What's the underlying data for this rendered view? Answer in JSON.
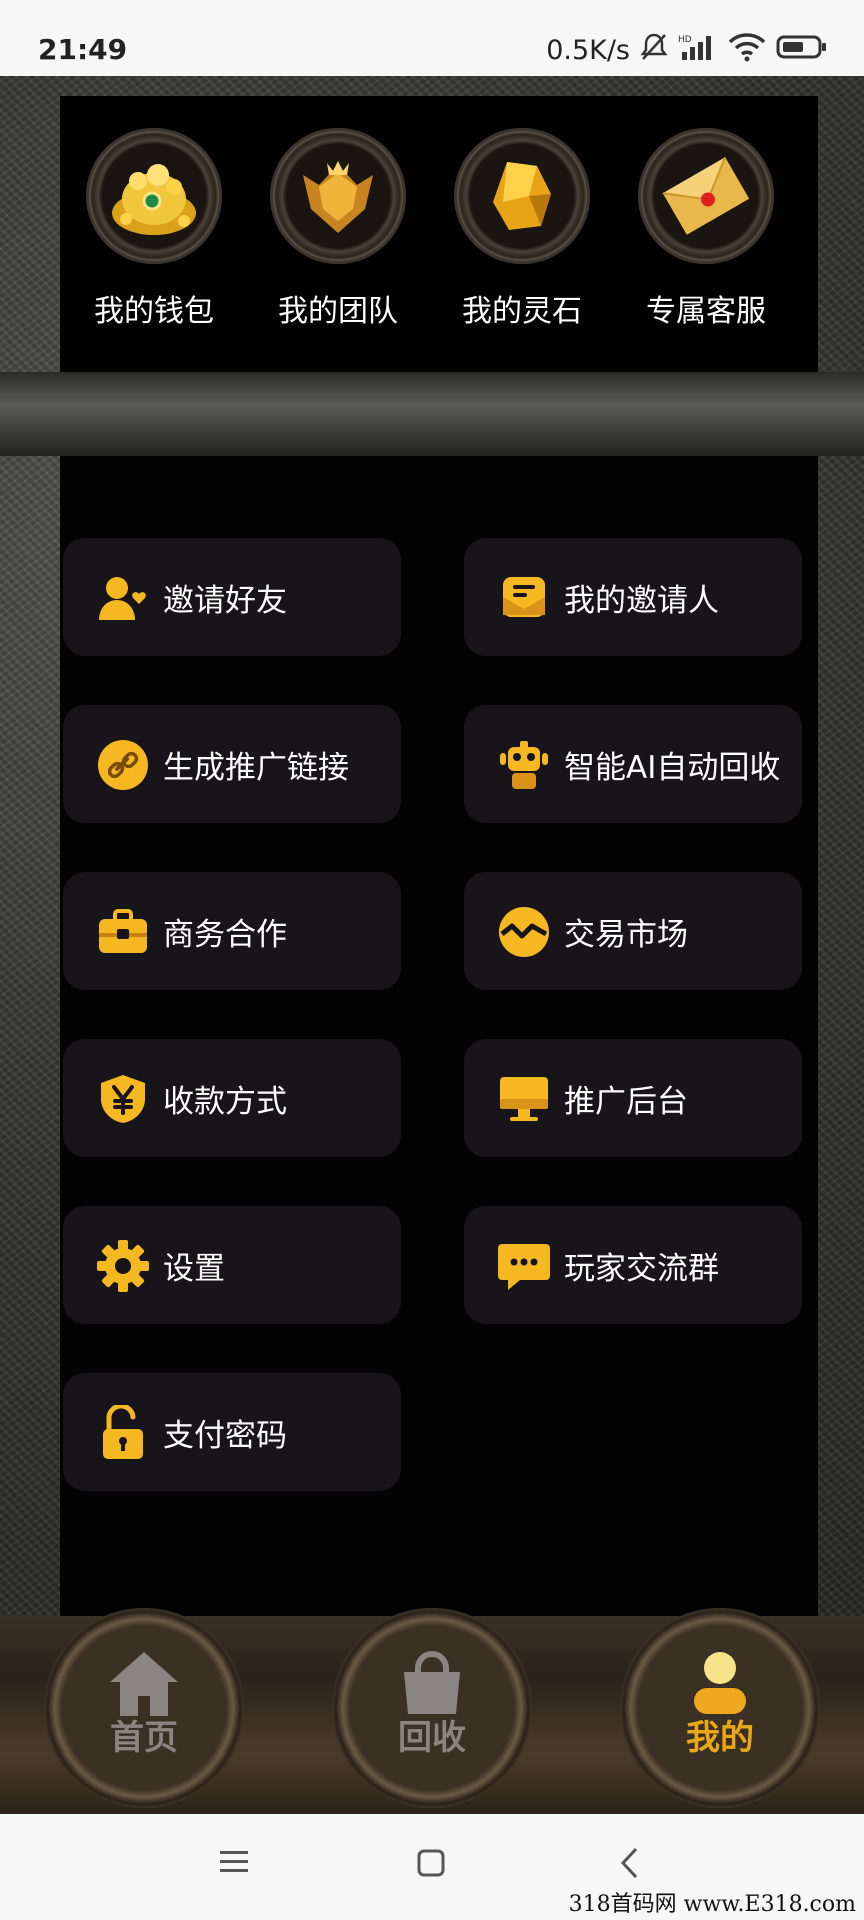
{
  "status_bar": {
    "time": "21:49",
    "speed": "0.5K/s",
    "icons": [
      "bell-off-icon",
      "signal-icon",
      "wifi-icon",
      "battery-icon"
    ]
  },
  "top_shortcuts": [
    {
      "label": "我的钱包",
      "icon": "treasure-bag-icon"
    },
    {
      "label": "我的团队",
      "icon": "shield-badge-icon"
    },
    {
      "label": "我的灵石",
      "icon": "gold-crystal-icon"
    },
    {
      "label": "专属客服",
      "icon": "envelope-icon"
    }
  ],
  "menu": [
    {
      "label": "邀请好友",
      "icon": "user-heart-icon"
    },
    {
      "label": "我的邀请人",
      "icon": "envelope-user-icon"
    },
    {
      "label": "生成推广链接",
      "icon": "link-icon"
    },
    {
      "label": "智能AI自动回收",
      "icon": "robot-icon"
    },
    {
      "label": "商务合作",
      "icon": "briefcase-icon"
    },
    {
      "label": "交易市场",
      "icon": "handshake-icon"
    },
    {
      "label": "收款方式",
      "icon": "yen-shield-icon"
    },
    {
      "label": "推广后台",
      "icon": "monitor-icon"
    },
    {
      "label": "设置",
      "icon": "gear-icon"
    },
    {
      "label": "玩家交流群",
      "icon": "chat-bubble-icon"
    },
    {
      "label": "支付密码",
      "icon": "unlock-icon"
    }
  ],
  "bottom_nav": [
    {
      "label": "首页",
      "icon": "home-icon",
      "active": false
    },
    {
      "label": "回收",
      "icon": "bag-icon",
      "active": false
    },
    {
      "label": "我的",
      "icon": "user-icon",
      "active": true
    }
  ],
  "colors": {
    "accent": "#f5b820",
    "inactive": "#8a8580",
    "active_label": "#e8a818"
  },
  "watermark": "318首码网 www.E318.com"
}
